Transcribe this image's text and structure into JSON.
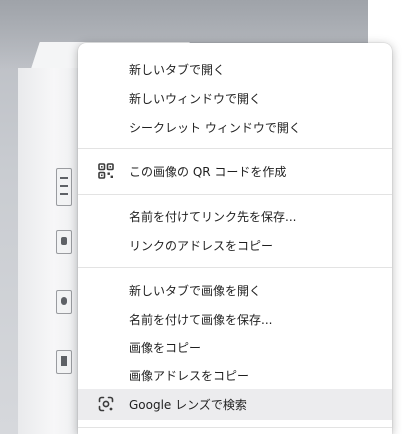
{
  "context_menu": {
    "group1": [
      {
        "label": "新しいタブで開く"
      },
      {
        "label": "新しいウィンドウで開く"
      },
      {
        "label": "シークレット ウィンドウで開く"
      }
    ],
    "group2": [
      {
        "label": "この画像の QR コードを作成",
        "icon": "qr-code-icon"
      }
    ],
    "group3": [
      {
        "label": "名前を付けてリンク先を保存..."
      },
      {
        "label": "リンクのアドレスをコピー"
      }
    ],
    "group4": [
      {
        "label": "新しいタブで画像を開く"
      },
      {
        "label": "名前を付けて画像を保存..."
      },
      {
        "label": "画像をコピー"
      },
      {
        "label": "画像アドレスをコピー"
      }
    ],
    "group5": [
      {
        "label": "Google レンズで検索",
        "icon": "google-lens-icon",
        "highlighted": true
      }
    ]
  },
  "colors": {
    "menu_background": "#ffffff",
    "highlight": "#ececee",
    "separator": "#e3e3e3",
    "text": "#1f1f1f"
  }
}
